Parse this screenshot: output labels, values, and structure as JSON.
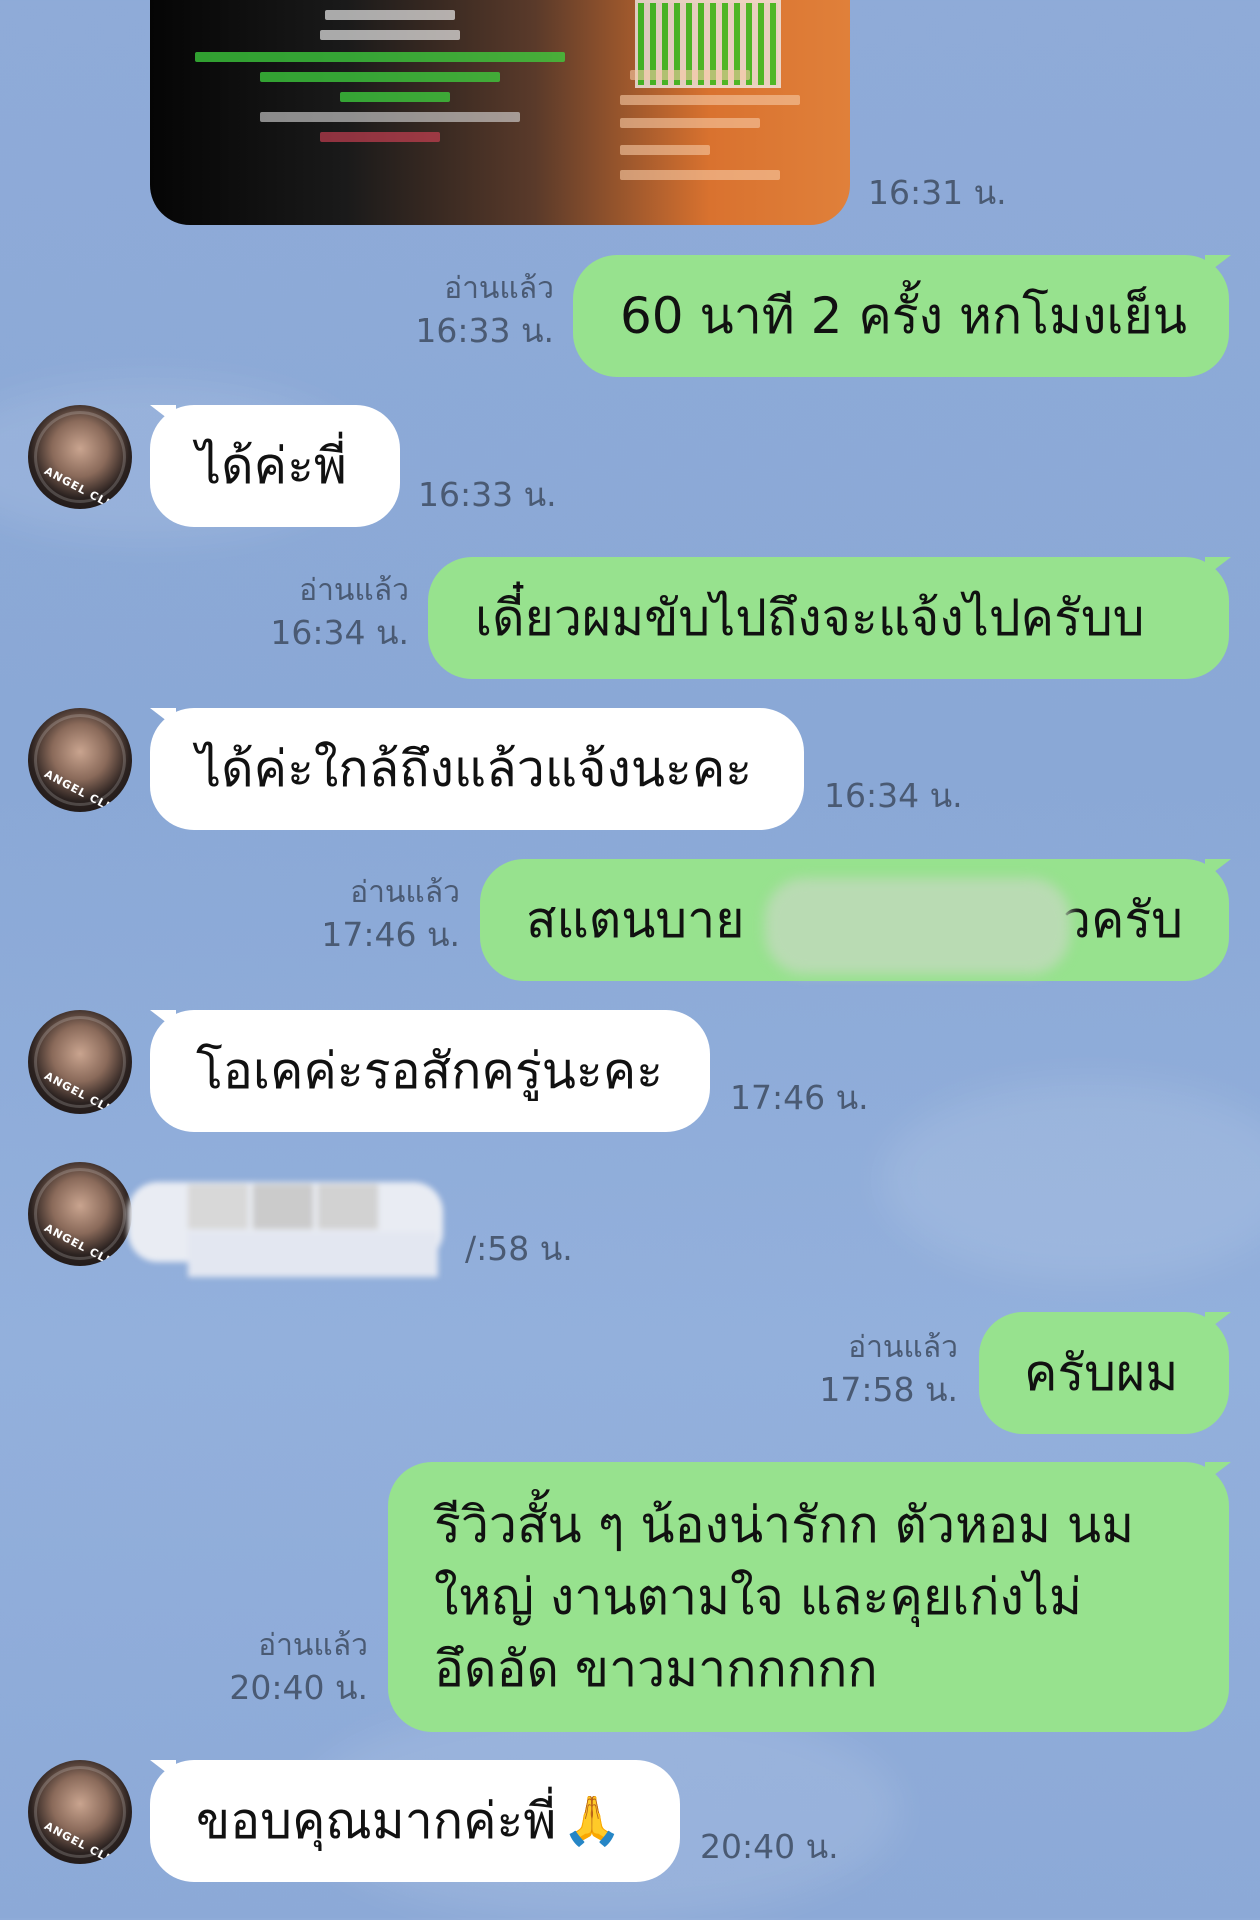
{
  "chat": {
    "read_label": "อ่านแล้ว",
    "messages": [
      {
        "side": "them",
        "kind": "image",
        "time": "16:31 น."
      },
      {
        "side": "me",
        "text": "60 นาที 2 ครั้ง หกโมงเย็น",
        "read": "อ่านแล้ว",
        "time": "16:33 น."
      },
      {
        "side": "them",
        "text": "ได้ค่ะพี่",
        "time": "16:33 น."
      },
      {
        "side": "me",
        "text": "เดี๋ยวผมขับไปถึงจะแจ้งไปครับบ",
        "read": "อ่านแล้ว",
        "time": "16:34 น."
      },
      {
        "side": "them",
        "text": "ได้ค่ะใกล้ถึงแล้วแจ้งนะคะ",
        "time": "16:34 น."
      },
      {
        "side": "me",
        "text_start": "สแตนบาย",
        "text_end": "วครับ",
        "read": "อ่านแล้ว",
        "time": "17:46 น."
      },
      {
        "side": "them",
        "text": "โอเคค่ะรอสักครู่นะคะ",
        "time": "17:46 น."
      },
      {
        "side": "them",
        "kind": "blurred",
        "time": "/:58 น."
      },
      {
        "side": "me",
        "text": "ครับผม",
        "read": "อ่านแล้ว",
        "time": "17:58 น."
      },
      {
        "side": "me",
        "lines": [
          "รีวิวสั้น ๆ น้องน่ารักก ตัวหอม นม",
          "ใหญ่ งานตามใจ และคุยเก่งไม่",
          "อึดอัด ขาวมากกกกก"
        ],
        "read": "อ่านแล้ว",
        "time": "20:40 น."
      },
      {
        "side": "them",
        "text": "ขอบคุณมากค่ะพี่",
        "emoji": "🙏",
        "time": "20:40 น."
      }
    ]
  },
  "avatar": {
    "logo_text": "ANGEL CLUB"
  },
  "colors": {
    "background": "#8fabd8",
    "me_bubble": "#97e28e",
    "them_bubble": "#ffffff",
    "meta_text": "#4a5a73"
  }
}
